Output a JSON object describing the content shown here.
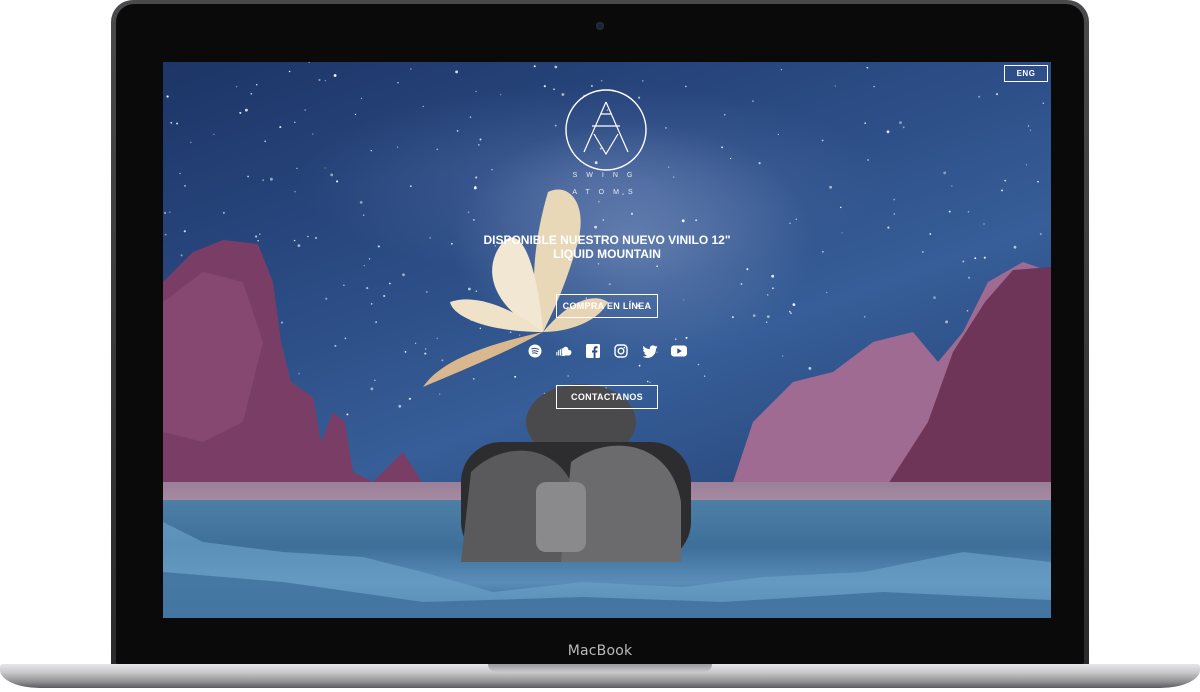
{
  "device": {
    "brand": "MacBook"
  },
  "site": {
    "language_button": "ENG",
    "logo": {
      "line1": "SWING",
      "line2": "ATOMS"
    },
    "headline": {
      "line1": "DISPONIBLE NUESTRO NUEVO VINILO 12\"",
      "line2": "LIQUID MOUNTAIN"
    },
    "buy_button": "COMPRA EN LÍNEA",
    "contact_button": "CONTACTANOS",
    "social_icons": [
      "spotify-icon",
      "soundcloud-icon",
      "facebook-icon",
      "instagram-icon",
      "twitter-icon",
      "youtube-icon"
    ]
  },
  "colors": {
    "sky": "#2c4d86",
    "rock": "#7a3e66",
    "text": "#ffffff",
    "frame": "#2a2a2c"
  }
}
